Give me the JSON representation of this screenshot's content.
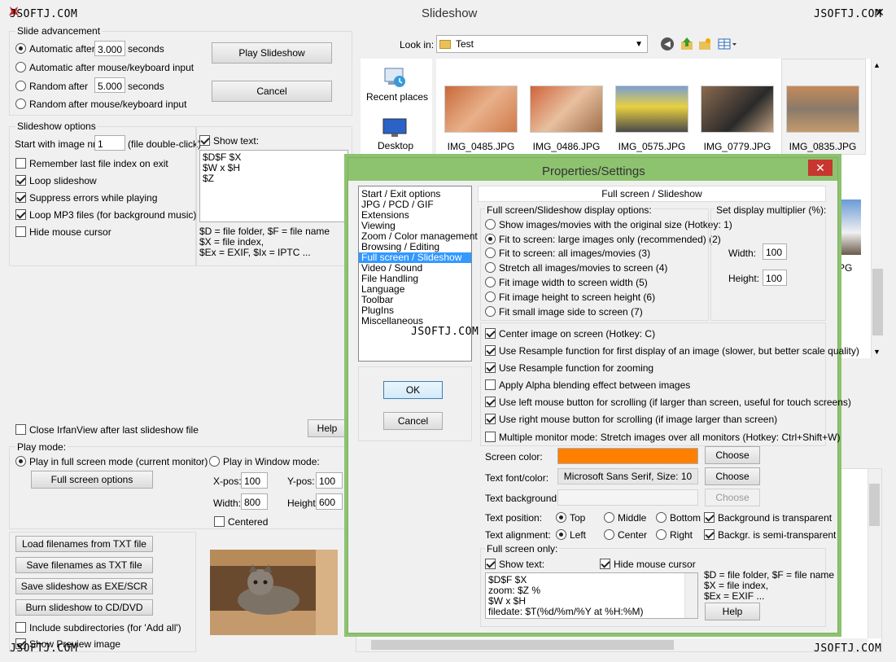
{
  "window": {
    "title": "Slideshow",
    "close_glyph": "✕"
  },
  "watermark": "JSOFTJ.COM",
  "slide_adv": {
    "group_label": "Slide advancement",
    "auto_after": "Automatic after",
    "auto_seconds": "3.000",
    "seconds": "seconds",
    "auto_input": "Automatic after mouse/keyboard input",
    "random": "Random",
    "after": "after",
    "random_seconds": "5.000",
    "random_input": "Random",
    "random_input_label": "after mouse/keyboard input"
  },
  "buttons": {
    "play": "Play Slideshow",
    "cancel": "Cancel",
    "help": "Help",
    "full_screen_options": "Full screen options"
  },
  "options": {
    "group_label": "Slideshow options",
    "start_label": "Start with image nr.:",
    "start_value": "1",
    "start_hint": "(file double-click)",
    "remember": "Remember last file index on exit",
    "loop": "Loop slideshow",
    "suppress": "Suppress errors while playing",
    "loop_mp3": "Loop MP3 files (for background music)",
    "hide_cursor": "Hide mouse cursor",
    "show_text": "Show text:",
    "text_value": "$D$F $X\n$W x $H\n$Z",
    "legend_1": "$D = file folder, $F = file name",
    "legend_2": "$X = file index,",
    "legend_3": "$Ex = EXIF, $Ix = IPTC ..."
  },
  "close_after": "Close IrfanView after last slideshow file",
  "play_mode": {
    "group_label": "Play mode:",
    "full": "Play in full screen mode (current monitor)",
    "window": "Play in Window mode:",
    "xpos": "X-pos:",
    "xpos_val": "100",
    "ypos": "Y-pos:",
    "ypos_val": "100",
    "width": "Width:",
    "width_val": "800",
    "height": "Height:",
    "height_val": "600",
    "centered": "Centered"
  },
  "file_buttons": {
    "load": "Load filenames from TXT file",
    "save": "Save filenames as TXT file",
    "save_exe": "Save slideshow as  EXE/SCR",
    "burn": "Burn slideshow to CD/DVD",
    "subdirs": "Include subdirectories (for 'Add all')",
    "preview": "Show Preview image"
  },
  "browser": {
    "look_in": "Look in:",
    "folder": "Test",
    "recent": "Recent places",
    "desktop": "Desktop",
    "thumbs": [
      "IMG_0485.JPG",
      "IMG_0486.JPG",
      "IMG_0575.JPG",
      "IMG_0779.JPG",
      "IMG_0835.JPG"
    ],
    "partial_label": "PG"
  },
  "dialog": {
    "title": "Properties/Settings",
    "close_glyph": "✕",
    "categories": [
      "Start / Exit options",
      "JPG / PCD / GIF",
      "Extensions",
      "Viewing",
      "Zoom / Color management",
      "Browsing / Editing",
      "Full screen / Slideshow",
      "Video / Sound",
      "File Handling",
      "Language",
      "Toolbar",
      "PlugIns",
      "Miscellaneous"
    ],
    "ok": "OK",
    "cancel": "Cancel",
    "header": "Full screen / Slideshow",
    "display_group": "Full screen/Slideshow display options:",
    "display_opts": [
      "Show images/movies with the original size (Hotkey: 1)",
      "Fit to screen: large images only (recommended) (2)",
      "Fit to screen: all images/movies (3)",
      "Stretch all images/movies to screen (4)",
      "Fit image width to screen width (5)",
      "Fit image height to screen height (6)",
      "Fit small image side to screen (7)"
    ],
    "multiplier_group": "Set display multiplier (%):",
    "mul_width": "Width:",
    "mul_width_val": "100",
    "mul_height": "Height:",
    "mul_height_val": "100",
    "checks": [
      "Center image on screen (Hotkey: C)",
      "Use Resample function for first display of an image (slower, but better scale quality)",
      "Use Resample function for zooming",
      "Apply Alpha blending effect between images",
      "Use left mouse button for scrolling (if larger than screen, useful for touch screens)",
      "Use right mouse button for scrolling (if image larger than screen)",
      "Multiple monitor mode: Stretch images over all monitors (Hotkey: Ctrl+Shift+W)"
    ],
    "screen_color": "Screen color:",
    "screen_color_hex": "#ff8000",
    "text_font": "Text font/color:",
    "font_value": "Microsoft Sans Serif, Size: 10",
    "text_bg": "Text background:",
    "choose": "Choose",
    "text_pos": "Text position:",
    "pos_top": "Top",
    "pos_middle": "Middle",
    "pos_bottom": "Bottom",
    "bg_transparent": "Background is transparent",
    "text_align": "Text alignment:",
    "align_left": "Left",
    "align_center": "Center",
    "align_right": "Right",
    "bg_semi": "Backgr. is semi-transparent",
    "fs_only": "Full screen only:",
    "show_text": "Show text:",
    "hide_cursor": "Hide mouse cursor",
    "fs_text": "$D$F $X\nzoom: $Z %\n$W x $H\nfiledate: $T(%d/%m/%Y at %H:%M)",
    "legend_1": "$D = file folder, $F = file name",
    "legend_2": "$X = file index,",
    "legend_3": "$Ex = EXIF ...",
    "help": "Help"
  }
}
